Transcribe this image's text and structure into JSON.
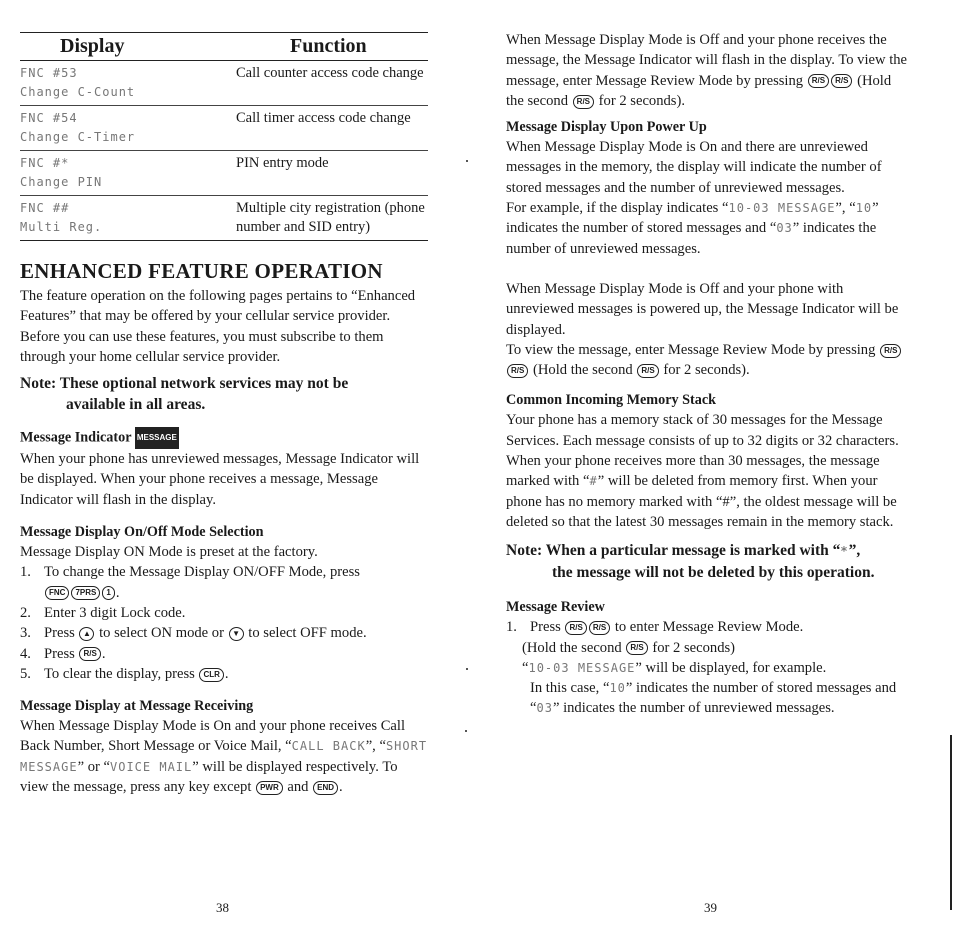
{
  "left_page": {
    "table": {
      "headers": [
        "Display",
        "Function"
      ],
      "rows": [
        {
          "display_line1": "FNC #53",
          "display_line2": "Change C-Count",
          "function": "Call counter access code change"
        },
        {
          "display_line1": "FNC #54",
          "display_line2": "Change C-Timer",
          "function": "Call timer access code change"
        },
        {
          "display_line1": "FNC #*",
          "display_line2": "Change PIN",
          "function": "PIN entry mode"
        },
        {
          "display_line1": "FNC ##",
          "display_line2": "Multi Reg.",
          "function": "Multiple city registration (phone number and SID entry)"
        }
      ]
    },
    "section_title": "ENHANCED FEATURE OPERATION",
    "intro": "The feature operation on the following pages pertains to “Enhanced Features” that may be offered by your cellular service provider. Before you can use these features, you must subscribe to them through your home cellular service provider.",
    "note_prefix": "Note: These optional network services may not be",
    "note_rest": "available in all areas.",
    "message_indicator": {
      "heading": "Message Indicator",
      "icon_label": "MESSAGE",
      "body": "When your phone has unreviewed messages, Message Indicator will be displayed. When your phone receives a message, Message Indicator will flash in the display."
    },
    "mode_selection": {
      "heading": "Message Display On/Off Mode Selection",
      "body": "Message Display ON Mode is preset at the factory.",
      "steps": [
        {
          "num": "1.",
          "text": "To change the Message Display ON/OFF Mode, press",
          "keys": [
            "FNC",
            "7PRS",
            "1"
          ]
        },
        {
          "num": "2.",
          "text": "Enter 3 digit Lock code."
        },
        {
          "num": "3.",
          "text_a": "Press",
          "key_a": "▲",
          "text_b": "to select ON mode or",
          "key_b": "▼",
          "text_c": "to select OFF mode."
        },
        {
          "num": "4.",
          "text": "Press",
          "key": "R/S"
        },
        {
          "num": "5.",
          "text": "To clear the display, press",
          "key": "CLR"
        }
      ]
    },
    "message_receiving": {
      "heading": "Message Display at Message Receiving",
      "body_a": "When Message Display Mode is On and your phone receives Call Back Number, Short Message or Voice Mail, “",
      "lcd_a": "CALL BACK",
      "body_b": "”, “",
      "lcd_b": "SHORT MESSAGE",
      "body_c": "” or “",
      "lcd_c": "VOICE MAIL",
      "body_d": "” will be displayed respectively. To view the message, press any key except",
      "key_pwr": "PWR",
      "and": "and",
      "key_end": "END"
    },
    "page_number": "38"
  },
  "right_page": {
    "para1": {
      "text": "When Message Display Mode is Off and your phone receives the message, the Message Indicator will flash in the display. To view the message, enter Message Review Mode by pressing",
      "keys": [
        "R/S",
        "R/S"
      ],
      "tail_a": "(Hold the second",
      "key": "R/S",
      "tail_b": "for 2 seconds)."
    },
    "power_up": {
      "heading": "Message Display Upon Power Up",
      "body": "When Message Display Mode is On and there are unreviewed messages in the memory, the display will indicate the number of stored messages and the number of unreviewed messages.",
      "example_a": "For example, if the display indicates “",
      "lcd_example": "10-03 MESSAGE",
      "example_b": "”, “",
      "lcd_10": "10",
      "example_c": "” indicates the number of stored messages and “",
      "lcd_03": "03",
      "example_d": "” indicates the number of unreviewed messages."
    },
    "power_off_para": {
      "text": "When Message Display Mode is Off and your phone with unreviewed messages is powered up, the Message Indicator will be displayed.",
      "text2": "To view the message, enter Message Review Mode by pressing",
      "keys": [
        "R/S",
        "R/S"
      ],
      "tail_a": "(Hold the second",
      "key": "R/S",
      "tail_b": "for 2 seconds)."
    },
    "memory_stack": {
      "heading": "Common Incoming Memory Stack",
      "body1": "Your phone has a memory stack of 30 messages for the Message Services. Each message consists of up to 32 digits or 32 characters.",
      "body2_a": "When your phone receives more than 30 messages, the message marked with “",
      "lcd_hash": "#",
      "body2_b": "” will be deleted from memory first. When your phone has no memory marked with “#”, the oldest message will be deleted so that the latest 30 messages remain in the memory stack."
    },
    "note": {
      "line1_a": "Note: When a particular message is marked with “",
      "star": "*",
      "line1_b": "”,",
      "line2": "the message will not be deleted by this operation."
    },
    "review": {
      "heading": "Message Review",
      "num": "1.",
      "press": "Press",
      "keys": [
        "R/S",
        "R/S"
      ],
      "tail": "to enter Message Review Mode.",
      "hold_a": "(Hold the second",
      "hold_key": "R/S",
      "hold_b": "for 2 seconds)",
      "lcd_example": "10-03 MESSAGE",
      "displayed": "” will be displayed, for example.",
      "case_a": "In this case, “",
      "lcd_10": "10",
      "case_b": "” indicates the number of stored messages and “",
      "lcd_03": "03",
      "case_c": "” indicates the number of unreviewed messages."
    },
    "page_number": "39"
  }
}
